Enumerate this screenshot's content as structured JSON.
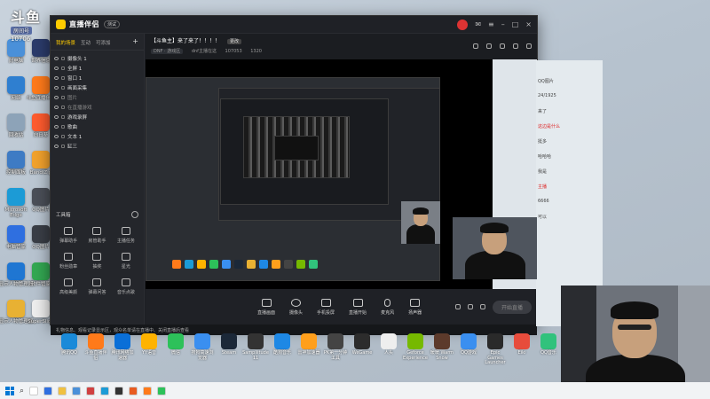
{
  "watermark": {
    "logo": "斗鱼",
    "room_id": "10706",
    "badge": "房间号"
  },
  "desktop_icons": [
    {
      "label": "此电脑",
      "color": "#4a90d9"
    },
    {
      "label": "网络",
      "color": "#2f7fd0"
    },
    {
      "label": "回收站",
      "color": "#8da3b8"
    },
    {
      "label": "控制面板",
      "color": "#3e7bc4"
    },
    {
      "label": "Microsoft Edge",
      "color": "#1c9bd6"
    },
    {
      "label": "电脑管家",
      "color": "#2f6fe0"
    },
    {
      "label": "显示人物管理器",
      "color": "#1f76d2"
    },
    {
      "label": "显示人物管理器",
      "color": "#e8b133"
    },
    {
      "label": "世界信息",
      "color": "#2b3b6b"
    },
    {
      "label": "斗鱼直播伴侣",
      "color": "#ff7a1a"
    },
    {
      "label": "向日葵",
      "color": "#ff5b2e"
    },
    {
      "label": "BandiZip",
      "color": "#f2a22c"
    },
    {
      "label": "QQ图片",
      "color": "#4b4f58"
    },
    {
      "label": "QQ图片",
      "color": "#3a3e46"
    },
    {
      "label": "软件管家",
      "color": "#33a852"
    },
    {
      "label": "SuperSlide",
      "color": "#eeeeee"
    }
  ],
  "window": {
    "app_title": "直播伴侣",
    "version_badge": "测试",
    "sidebar_tabs": [
      "我的场景",
      "互动",
      "可添加"
    ],
    "sources": [
      {
        "label": "摄像头 1",
        "dim": false
      },
      {
        "label": "全屏 1",
        "dim": false
      },
      {
        "label": "窗口 1",
        "dim": false
      },
      {
        "label": "画面采集",
        "dim": false
      },
      {
        "label": "图片",
        "dim": true
      },
      {
        "label": "在直播游戏",
        "dim": true
      },
      {
        "label": "游戏录屏",
        "dim": false
      },
      {
        "label": "歌曲",
        "dim": false
      },
      {
        "label": "文本 1",
        "dim": false
      },
      {
        "label": "缸三",
        "dim": false
      }
    ],
    "tools_label": "工具箱",
    "tools": [
      "弹幕助手",
      "房管助手",
      "主播任务",
      "粉丝勋章",
      "抽奖",
      "星光",
      "高级美颜",
      "弹幕问答",
      "音乐点歌"
    ],
    "room_title": "【斗鱼主】来了来了！！！！",
    "room_tag": "更改",
    "room_sub": [
      "DNF · 游戏区",
      "dnf主播在这",
      "107053",
      "1320"
    ],
    "bottom_buttons": [
      "直播画面",
      "摄像头",
      "手机投屏",
      "直播开始"
    ],
    "mic_label": "麦克风",
    "speaker_label": "扬声器",
    "go_live": "开始直播",
    "notice": "礼物信息、观看记录显示区，观众名单请在直播中、关闭直播后查看"
  },
  "chat_lines": [
    {
      "text": "QQ图片",
      "red": false
    },
    {
      "text": "24/1925",
      "red": false
    },
    {
      "text": "来了",
      "red": false
    },
    {
      "text": "这边是什么",
      "red": true
    },
    {
      "text": "挺多",
      "red": false
    },
    {
      "text": "哈哈哈",
      "red": false
    },
    {
      "text": "我是",
      "red": false
    },
    {
      "text": "主播",
      "red": true
    },
    {
      "text": "6666",
      "red": false
    },
    {
      "text": "可以",
      "red": false
    }
  ],
  "dock_icons": [
    {
      "label": "腾讯QQ",
      "color": "#1a8ad9"
    },
    {
      "label": "斗鱼直播伴侣",
      "color": "#ff7a1a"
    },
    {
      "label": "腾讯网络加速器",
      "color": "#0a6fd8"
    },
    {
      "label": "YY语音",
      "color": "#ffb300"
    },
    {
      "label": "微信",
      "color": "#2dc15a"
    },
    {
      "label": "搜狗高速浏览器",
      "color": "#3a8ff0"
    },
    {
      "label": "Steam",
      "color": "#1b2838"
    },
    {
      "label": "Sampliitude 11",
      "color": "#333333"
    },
    {
      "label": "酷狗音乐",
      "color": "#1e88e5"
    },
    {
      "label": "雷神加速器",
      "color": "#ff9f1c"
    },
    {
      "label": "PK第一分钟工具",
      "color": "#444444"
    },
    {
      "label": "WeGame",
      "color": "#2c2c2c"
    },
    {
      "label": "人头",
      "color": "#eeeeee"
    },
    {
      "label": "Geforce Experience",
      "color": "#76b900"
    },
    {
      "label": "暖暖 Warm Snow",
      "color": "#5c3a2b"
    },
    {
      "label": "QQ游戏",
      "color": "#3a8ff0"
    },
    {
      "label": "Epic Games Launcher",
      "color": "#2a2a2a"
    },
    {
      "label": "Eiki",
      "color": "#e74c3c"
    },
    {
      "label": "QQ音乐",
      "color": "#31c27c"
    }
  ],
  "taskbar_colors": [
    "#ffffff",
    "#2f6fe0",
    "#f0c040",
    "#4a90d9",
    "#d04040",
    "#1c9bd6",
    "#333333",
    "#e85b20",
    "#ff7a1a",
    "#2dc15a"
  ]
}
